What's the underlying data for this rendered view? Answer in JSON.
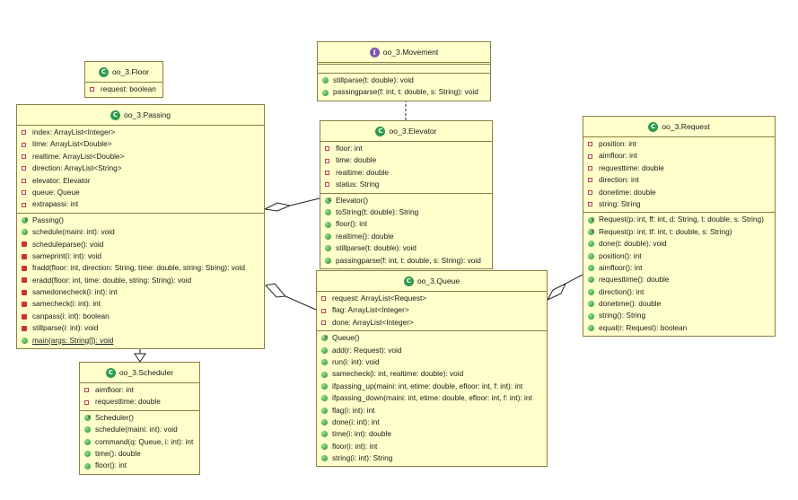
{
  "classes": {
    "floor": {
      "title": "oo_3.Floor",
      "kind": "class",
      "fields": [
        {
          "text": "request: boolean",
          "vis": "field"
        }
      ],
      "methods": []
    },
    "movement": {
      "title": "oo_3.Movement",
      "kind": "interface",
      "fields": [],
      "methods": [
        {
          "text": "stillparse(t: double): void",
          "vis": "public"
        },
        {
          "text": "passingparse(f: int, t: double, s: String): void",
          "vis": "public"
        }
      ]
    },
    "passing": {
      "title": "oo_3.Passing",
      "kind": "class",
      "fields": [
        {
          "text": "index: ArrayList<Integer>",
          "vis": "field"
        },
        {
          "text": "time: ArrayList<Double>",
          "vis": "field"
        },
        {
          "text": "realtime: ArrayList<Double>",
          "vis": "field"
        },
        {
          "text": "direction: ArrayList<String>",
          "vis": "field"
        },
        {
          "text": "elevator: Elevator",
          "vis": "field"
        },
        {
          "text": "queue: Queue",
          "vis": "field"
        },
        {
          "text": "extrapassi: int",
          "vis": "field"
        }
      ],
      "methods": [
        {
          "text": "Passing()",
          "vis": "ctor"
        },
        {
          "text": "schedule(maini: int): void",
          "vis": "public"
        },
        {
          "text": "scheduleparse(): void",
          "vis": "private"
        },
        {
          "text": "sameprint(i: int): void",
          "vis": "private"
        },
        {
          "text": "fradd(floor: int, direction: String, time: double, string: String): void",
          "vis": "private"
        },
        {
          "text": "eradd(floor: int, time: double, string: String): void",
          "vis": "private"
        },
        {
          "text": "samedonecheck(i: int): int",
          "vis": "private"
        },
        {
          "text": "samecheck(i: int): int",
          "vis": "private"
        },
        {
          "text": "canpass(i: int): boolean",
          "vis": "private"
        },
        {
          "text": "stillparse(i: int): void",
          "vis": "private"
        },
        {
          "text": "main(args: String[]): void",
          "vis": "static"
        }
      ]
    },
    "elevator": {
      "title": "oo_3.Elevator",
      "kind": "class",
      "fields": [
        {
          "text": "floor: int",
          "vis": "field"
        },
        {
          "text": "time: double",
          "vis": "field"
        },
        {
          "text": "realtime: double",
          "vis": "field"
        },
        {
          "text": "status: String",
          "vis": "field"
        }
      ],
      "methods": [
        {
          "text": "Elevator()",
          "vis": "ctor"
        },
        {
          "text": "toString(t: double): String",
          "vis": "public"
        },
        {
          "text": "floor(): int",
          "vis": "public"
        },
        {
          "text": "realtime(): double",
          "vis": "public"
        },
        {
          "text": "stillparse(t: double): void",
          "vis": "public"
        },
        {
          "text": "passingparse(f: int, t: double, s: String): void",
          "vis": "public"
        }
      ]
    },
    "request": {
      "title": "oo_3.Request",
      "kind": "class",
      "fields": [
        {
          "text": "position: int",
          "vis": "field"
        },
        {
          "text": "aimfloor: int",
          "vis": "field"
        },
        {
          "text": "requesttime: double",
          "vis": "field"
        },
        {
          "text": "direction: int",
          "vis": "field"
        },
        {
          "text": "donetime: double",
          "vis": "field"
        },
        {
          "text": "string: String",
          "vis": "field"
        }
      ],
      "methods": [
        {
          "text": "Request(p: int, ff: int, d: String, t: double, s: String)",
          "vis": "ctor"
        },
        {
          "text": "Request(p: int, tf: int, t: double, s: String)",
          "vis": "ctor"
        },
        {
          "text": "done(t: double): void",
          "vis": "public"
        },
        {
          "text": "position(): int",
          "vis": "public"
        },
        {
          "text": "aimfloor(): int",
          "vis": "public"
        },
        {
          "text": "requesttime(): double",
          "vis": "public"
        },
        {
          "text": "direction(): int",
          "vis": "public"
        },
        {
          "text": "donetime(): double",
          "vis": "public"
        },
        {
          "text": "string(): String",
          "vis": "public"
        },
        {
          "text": "equal(r: Request): boolean",
          "vis": "public"
        }
      ]
    },
    "queue": {
      "title": "oo_3.Queue",
      "kind": "class",
      "fields": [
        {
          "text": "request: ArrayList<Request>",
          "vis": "field"
        },
        {
          "text": "flag: ArrayList<Integer>",
          "vis": "field"
        },
        {
          "text": "done: ArrayList<Integer>",
          "vis": "field"
        }
      ],
      "methods": [
        {
          "text": "Queue()",
          "vis": "ctor"
        },
        {
          "text": "add(r: Request): void",
          "vis": "public"
        },
        {
          "text": "run(i: int): void",
          "vis": "public"
        },
        {
          "text": "samecheck(i: int, realtime: double): void",
          "vis": "public"
        },
        {
          "text": "ifpassing_up(maini: int, etime: double, efloor: int, f: int): int",
          "vis": "public"
        },
        {
          "text": "ifpassing_down(maini: int, etime: double, efloor: int, f: int): int",
          "vis": "public"
        },
        {
          "text": "flag(i: int): int",
          "vis": "public"
        },
        {
          "text": "done(i: int): int",
          "vis": "public"
        },
        {
          "text": "time(i: int): double",
          "vis": "public"
        },
        {
          "text": "floor(i: int): int",
          "vis": "public"
        },
        {
          "text": "string(i: int): String",
          "vis": "public"
        }
      ]
    },
    "scheduler": {
      "title": "oo_3.Scheduler",
      "kind": "class",
      "fields": [
        {
          "text": "aimfloor: int",
          "vis": "field"
        },
        {
          "text": "requesttime: double",
          "vis": "field"
        }
      ],
      "methods": [
        {
          "text": "Scheduler()",
          "vis": "ctor"
        },
        {
          "text": "schedule(maini: int): void",
          "vis": "public"
        },
        {
          "text": "command(q: Queue, i: int): int",
          "vis": "public"
        },
        {
          "text": "time(): double",
          "vis": "public"
        },
        {
          "text": "floor(): int",
          "vis": "public"
        }
      ]
    }
  },
  "relations": [
    {
      "from": "elevator",
      "to": "movement",
      "type": "realization"
    },
    {
      "from": "passing",
      "to": "scheduler",
      "type": "generalization"
    },
    {
      "from": "passing",
      "to": "elevator",
      "type": "aggregation"
    },
    {
      "from": "passing",
      "to": "queue",
      "type": "aggregation"
    },
    {
      "from": "queue",
      "to": "request",
      "type": "aggregation"
    }
  ]
}
